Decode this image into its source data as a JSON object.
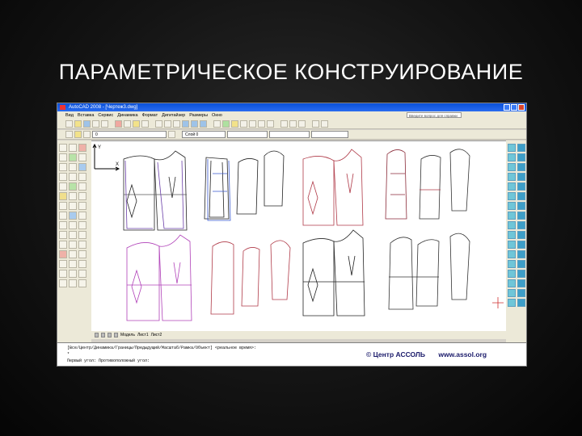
{
  "slide": {
    "title": "ПАРАМЕТРИЧЕСКОЕ КОНСТРУИРОВАНИЕ"
  },
  "window": {
    "title": "AutoCAD 2008 - [Чертеж3.dwg]"
  },
  "menu": [
    "Вид",
    "Вставка",
    "Сервис",
    "Динамика",
    "Формат",
    "Дигитайзер",
    "Размеры",
    "Окно"
  ],
  "help_search": {
    "placeholder": "Введите вопрос для справки"
  },
  "toolbar": {
    "layer_value": "0",
    "layer2_value": "Слой 0"
  },
  "tabs": [
    "Модель",
    "Лист1",
    "Лист2"
  ],
  "command_line": {
    "line1": "[Все/Центр/Динамика/Границы/Предыдущий/Масштаб/Рамка/Объект] <реальное время>:",
    "line2": "*",
    "line3": "Первый угол: Противоположный угол:"
  },
  "watermark": {
    "brand": "© Центр АССОЛЬ",
    "url": "www.assol.org"
  },
  "colors": {
    "accent_red": "#b03a48",
    "accent_magenta": "#b040b8",
    "accent_blue": "#2a3bb0"
  }
}
